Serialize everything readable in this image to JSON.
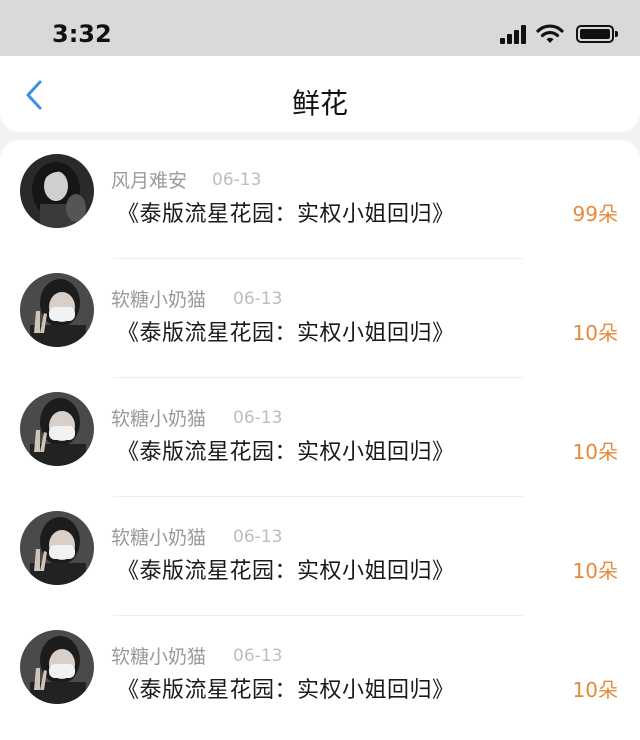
{
  "status_bar": {
    "time": "3:32"
  },
  "nav": {
    "title": "鲜花",
    "back_icon": "chevron-left-icon",
    "accent_color": "#3d8ee8"
  },
  "gifts": [
    {
      "user": "风月难安",
      "date": "06-13",
      "book": "《泰版流星花园：实权小姐回归》",
      "amount": "99朵",
      "avatar": "dark-hair-portrait"
    },
    {
      "user": "软糖小奶猫",
      "date": "06-13",
      "book": "《泰版流星花园：实权小姐回归》",
      "amount": "10朵",
      "avatar": "masked-peace-sign"
    },
    {
      "user": "软糖小奶猫",
      "date": "06-13",
      "book": "《泰版流星花园：实权小姐回归》",
      "amount": "10朵",
      "avatar": "masked-peace-sign"
    },
    {
      "user": "软糖小奶猫",
      "date": "06-13",
      "book": "《泰版流星花园：实权小姐回归》",
      "amount": "10朵",
      "avatar": "masked-peace-sign"
    },
    {
      "user": "软糖小奶猫",
      "date": "06-13",
      "book": "《泰版流星花园：实权小姐回归》",
      "amount": "10朵",
      "avatar": "masked-peace-sign"
    }
  ],
  "colors": {
    "amount": "#e8893a",
    "secondary_text": "#9a9a9a"
  }
}
